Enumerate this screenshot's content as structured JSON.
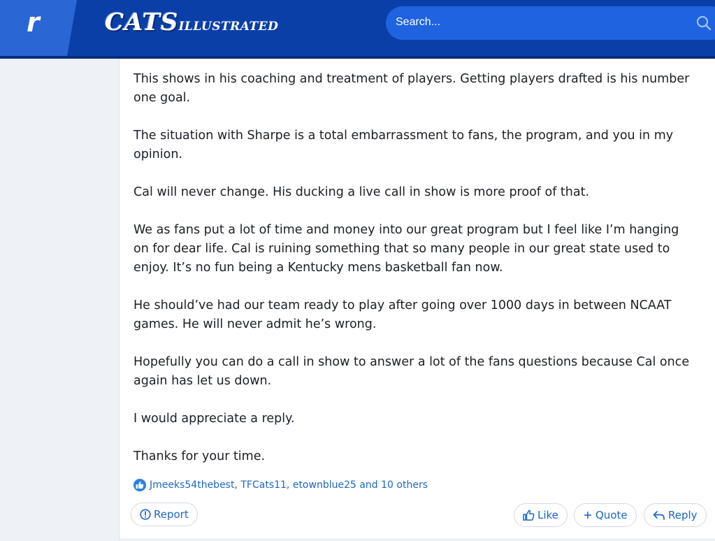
{
  "header": {
    "logo_letter": "r",
    "brand_main": "CATS",
    "brand_sub": "ILLUSTRATED",
    "search_placeholder": "Search..."
  },
  "post": {
    "paragraphs": [
      "This shows in his coaching and treatment of players. Getting players drafted is his number one goal.",
      "The situation with Sharpe is a total embarrassment to fans, the program, and you in my opinion.",
      "Cal will never change. His ducking a live call in show is more proof of that.",
      "We as fans put a lot of time and money into our great program but I feel like I’m hanging on for dear life. Cal is ruining something that so many people in our great state used to enjoy. It’s no fun being a Kentucky mens basketball fan now.",
      "He should’ve had our team ready to play after going over 1000 days in between NCAAT games. He will never admit he’s wrong.",
      "Hopefully you can do a call in show to answer a lot of the fans questions because Cal once again has let us down.",
      "I would appreciate a reply.",
      "Thanks for your time."
    ],
    "reactions_text": "Jmeeks54thebest, TFCats11, etownblue25 and 10 others"
  },
  "actions": {
    "report": "Report",
    "like": "Like",
    "quote": "Quote",
    "reply": "Reply"
  },
  "icons": {
    "logo": "rivals-logo-icon",
    "search": "search-icon",
    "reaction": "thumbs-up-badge-icon",
    "report": "alert-circle-icon",
    "like": "thumbs-up-icon",
    "quote": "plus-icon",
    "reply": "reply-arrow-icon"
  },
  "colors": {
    "header_bg": "#0b3fa8",
    "search_bg": "#1f63e0",
    "link": "#1a66c7",
    "text": "#1b1f24"
  }
}
